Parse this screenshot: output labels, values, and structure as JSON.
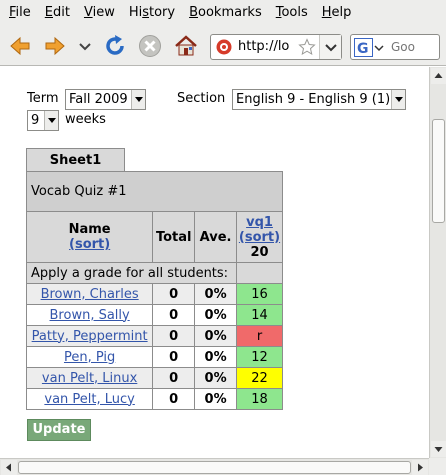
{
  "menu": [
    "File",
    "Edit",
    "View",
    "History",
    "Bookmarks",
    "Tools",
    "Help"
  ],
  "menu_underline": [
    "F",
    "E",
    "V",
    "s",
    "B",
    "T",
    "H"
  ],
  "url": "http://lo",
  "search": {
    "placeholder": "Goo"
  },
  "term": {
    "label": "Term",
    "value": "Fall 2009"
  },
  "section": {
    "label": "Section",
    "value": "English 9 - English 9 (1)"
  },
  "weeks": {
    "value": "9",
    "label": "weeks"
  },
  "sheet_tab": "Sheet1",
  "table": {
    "title": "Vocab Quiz #1",
    "col_name": "Name",
    "sort_label": "(sort)",
    "col_total": "Total",
    "col_ave": "Ave.",
    "assignment": {
      "name": "vq1",
      "sort": "(sort)",
      "points": "20"
    },
    "apply_text": "Apply a grade for all students:",
    "rows": [
      {
        "name": "Brown, Charles",
        "total": "0",
        "ave": "0%",
        "grade": "16"
      },
      {
        "name": "Brown, Sally",
        "total": "0",
        "ave": "0%",
        "grade": "14"
      },
      {
        "name": "Patty, Peppermint",
        "total": "0",
        "ave": "0%",
        "grade": "r"
      },
      {
        "name": "Pen, Pig",
        "total": "0",
        "ave": "0%",
        "grade": "12"
      },
      {
        "name": "van Pelt, Linux",
        "total": "0",
        "ave": "0%",
        "grade": "22"
      },
      {
        "name": "van Pelt, Lucy",
        "total": "0",
        "ave": "0%",
        "grade": "18"
      }
    ]
  },
  "grade_colors": [
    "#8ee68e",
    "#8ee68e",
    "#f06a6a",
    "#8ee68e",
    "#ffff00",
    "#8ee68e"
  ],
  "update_label": "Update",
  "icons": [
    "back-arrow-icon",
    "forward-arrow-icon",
    "history-dropdown-icon",
    "reload-icon",
    "stop-icon",
    "home-icon",
    "site-icon",
    "bookmark-star-icon",
    "google-search-icon"
  ]
}
